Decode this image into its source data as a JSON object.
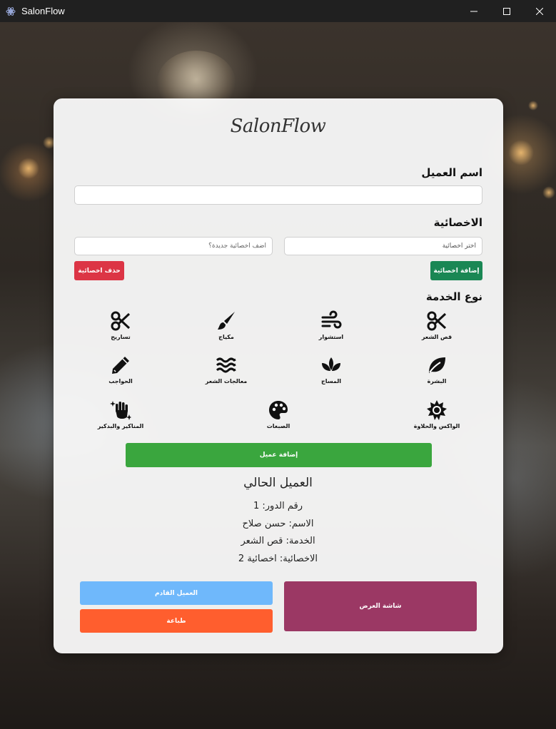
{
  "window": {
    "title": "SalonFlow"
  },
  "logo": "SalonFlow",
  "client_name": {
    "label": "اسم العميل",
    "value": ""
  },
  "specialist": {
    "label": "الاخصائية",
    "select_value": "اختر اخصائية",
    "new_placeholder": "أضف اخصائية جديدة؟",
    "add_label": "إضافة اخصائية",
    "delete_label": "حذف اخصائية"
  },
  "service_type": {
    "label": "نوع الخدمة",
    "items": [
      {
        "label": "قص الشعر",
        "icon": "scissors-icon"
      },
      {
        "label": "استشوار",
        "icon": "wind-icon"
      },
      {
        "label": "مكياج",
        "icon": "brush-icon"
      },
      {
        "label": "تساريح",
        "icon": "scissors-icon"
      },
      {
        "label": "البشرة",
        "icon": "leaf-icon"
      },
      {
        "label": "المساج",
        "icon": "spa-icon"
      },
      {
        "label": "معالجات الشعر",
        "icon": "water-icon"
      },
      {
        "label": "الحواجب",
        "icon": "pencil-icon"
      },
      {
        "label": "الواكس والحلاوة",
        "icon": "sun-icon"
      },
      {
        "label": "الصبغات",
        "icon": "palette-icon"
      },
      {
        "label": "المناكير والبدكير",
        "icon": "hand-sparkles-icon"
      }
    ]
  },
  "add_client_label": "إضافة عميل",
  "current_client": {
    "title": "العميل الحالي",
    "queue": "رقم الدور: 1",
    "name": "الاسم: حسن صلاح",
    "service": "الخدمة: قص الشعر",
    "specialist": "الاخصائية: اخصائية 2"
  },
  "actions": {
    "next_label": "العميل القادم",
    "print_label": "طباعة",
    "display_label": "شاشة العرض"
  },
  "colors": {
    "add_specialist": "#1a8754",
    "delete_specialist": "#dc3545",
    "add_client": "#3aa63e",
    "next": "#6fb8fb",
    "print": "#ff5e2e",
    "display": "#9b3864"
  }
}
